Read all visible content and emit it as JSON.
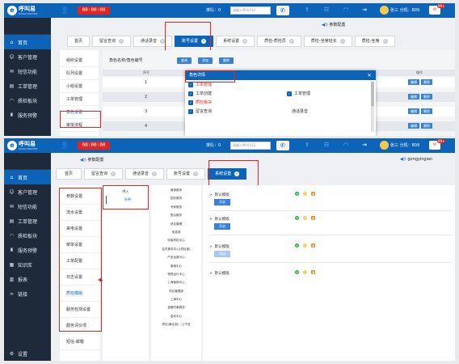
{
  "app": {
    "logo_text": "呼叫易",
    "logo_sub": "GOGO DOCTOR",
    "logo_glyph": "e"
  },
  "top": {
    "timer": "00:00:00",
    "queue": "排队：0",
    "search_placeholder": "请输入呼叫号码",
    "user_name": "张三 分机：809",
    "mail_label": "✉",
    "mail_badge": "99+",
    "colors": {
      "brand": "#0d63b8",
      "sidebar": "#1e2a3a",
      "alert": "#e8231b"
    }
  },
  "screen1": {
    "sidebar": [
      {
        "icon": "home-icon",
        "label": "首页",
        "active": true
      },
      {
        "icon": "customers-icon",
        "label": "客户管理"
      },
      {
        "icon": "sms-icon",
        "label": "短信功能"
      },
      {
        "icon": "ticket-icon",
        "label": "工单管理"
      },
      {
        "icon": "qa-icon",
        "label": "质检板块"
      },
      {
        "icon": "service-icon",
        "label": "服务预警"
      }
    ],
    "tabs": [
      {
        "label": "首页"
      },
      {
        "label": "留言查询"
      },
      {
        "label": "通话录音"
      },
      {
        "label": "账号设置",
        "active": true
      },
      {
        "label": "系统设置"
      },
      {
        "label": "质检-质检员"
      },
      {
        "label": "质检-坐席班长"
      },
      {
        "label": "质检-坐席"
      }
    ],
    "notice": "参数配置",
    "left_menu": [
      "组织设置",
      "队列设置",
      "小组设置",
      "工单管理",
      "角色设置",
      "审批流程"
    ],
    "toolbar_label": "角色名称/角色编号",
    "buttons": [
      "查询",
      "添加",
      "删除"
    ],
    "grid_head": [
      "序号",
      "操作"
    ],
    "rows": [
      "1",
      "2",
      "3",
      "4"
    ],
    "row_actions": [
      "编辑",
      "删除"
    ],
    "modal": {
      "title": "角色详情",
      "close": "×",
      "groups": [
        {
          "label": "工单管理",
          "items": [
            [
              "工单创建",
              "工单管理"
            ]
          ]
        },
        {
          "label": "质检板块",
          "items": [
            [
              "留言查询",
              "通话录音"
            ]
          ]
        }
      ]
    }
  },
  "screen2": {
    "sidebar": [
      {
        "icon": "home-icon",
        "label": "首页",
        "active": true
      },
      {
        "icon": "customers-icon",
        "label": "客户管理"
      },
      {
        "icon": "sms-icon",
        "label": "短信功能"
      },
      {
        "icon": "ticket-icon",
        "label": "工单管理"
      },
      {
        "icon": "qa-icon",
        "label": "质检板块"
      },
      {
        "icon": "service-icon",
        "label": "服务预警"
      },
      {
        "icon": "kb-icon",
        "label": "知识库"
      },
      {
        "icon": "report-icon",
        "label": "报表"
      },
      {
        "icon": "link-icon",
        "label": "链接"
      }
    ],
    "settings_label": "设置",
    "notice_left": "参数配置",
    "notice_right": "gongyingian",
    "tabs": [
      {
        "label": "首页"
      },
      {
        "label": "留言查询"
      },
      {
        "label": "通话录音"
      },
      {
        "label": "账号设置"
      },
      {
        "label": "系统设置",
        "active": true
      }
    ],
    "col1": [
      "参数设置",
      "流水设置",
      "来电设置",
      "菜单设置",
      "工单配置",
      "日志设置",
      "质检模版",
      "服务检测设置",
      "服务评价项",
      "短信-邮箱"
    ],
    "col2": [
      "呼入",
      "外呼"
    ],
    "col3": [
      "营销服务",
      "回访服务",
      "专家服务",
      "售后服务",
      "综合管理",
      "信息部",
      "玩易质检中心",
      "会员服务中心(质检部)",
      "产品运营中心",
      "营销中心",
      "物资运行中心",
      "上海营销中心",
      "项目管理部",
      "上海中心",
      "金融同事服务",
      "金利中心",
      "质控(事业部)（上午班"
    ],
    "templates": [
      {
        "name": "默认模版",
        "btn": "开启",
        "enabled": true
      },
      {
        "name": "默认模版",
        "btn": "开启",
        "enabled": true
      },
      {
        "name": "默认模版",
        "btn": "关闭",
        "enabled": false
      },
      {
        "name": "默认模版",
        "btn": "",
        "enabled": true
      }
    ]
  }
}
